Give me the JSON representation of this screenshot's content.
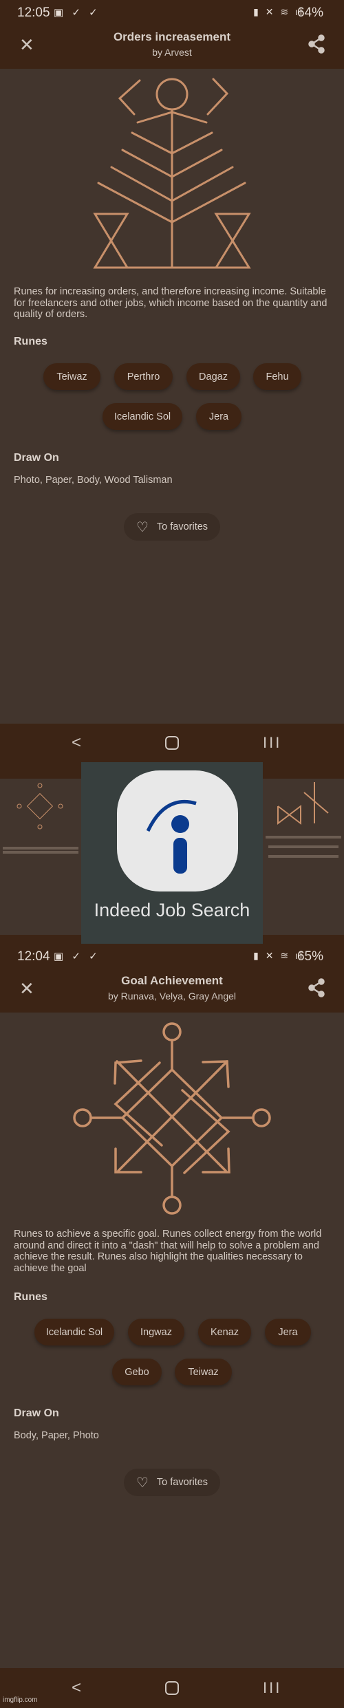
{
  "colors": {
    "header": "#3c2415",
    "background": "#42352d",
    "chip": "#3e2414",
    "rune_stroke": "#c8906a",
    "indeed_blue": "#0b3b8e"
  },
  "screen1": {
    "status": {
      "time": "12:05",
      "battery": "64%"
    },
    "title": "Orders increasement",
    "author": "by Arvest",
    "description": "Runes for increasing orders,  and therefore increasing income.  Suitable for freelancers and other jobs,  which income based on the quantity and quality of orders.",
    "runes_heading": "Runes",
    "runes": [
      "Teiwaz",
      "Perthro",
      "Dagaz",
      "Fehu",
      "Icelandic Sol",
      "Jera"
    ],
    "draw_on_heading": "Draw On",
    "draw_on": "Photo, Paper, Body, Wood Talisman",
    "favorites": "To favorites"
  },
  "switcher": {
    "app_name": "Indeed Job Search"
  },
  "screen2": {
    "status": {
      "time": "12:04",
      "battery": "65%"
    },
    "title": "Goal Achievement",
    "author": "by Runava, Velya, Gray Angel",
    "description": "Runes to achieve a specific goal. Runes collect energy from the world around and direct it into a \"dash\" that will help to solve a problem and achieve the result. Runes also highlight the qualities necessary to achieve the goal",
    "runes_heading": "Runes",
    "runes": [
      "Icelandic Sol",
      "Ingwaz",
      "Kenaz",
      "Jera",
      "Gebo",
      "Teiwaz"
    ],
    "draw_on_heading": "Draw On",
    "draw_on": "Body, Paper, Photo",
    "favorites": "To favorites"
  },
  "watermark": "imgflip.com"
}
